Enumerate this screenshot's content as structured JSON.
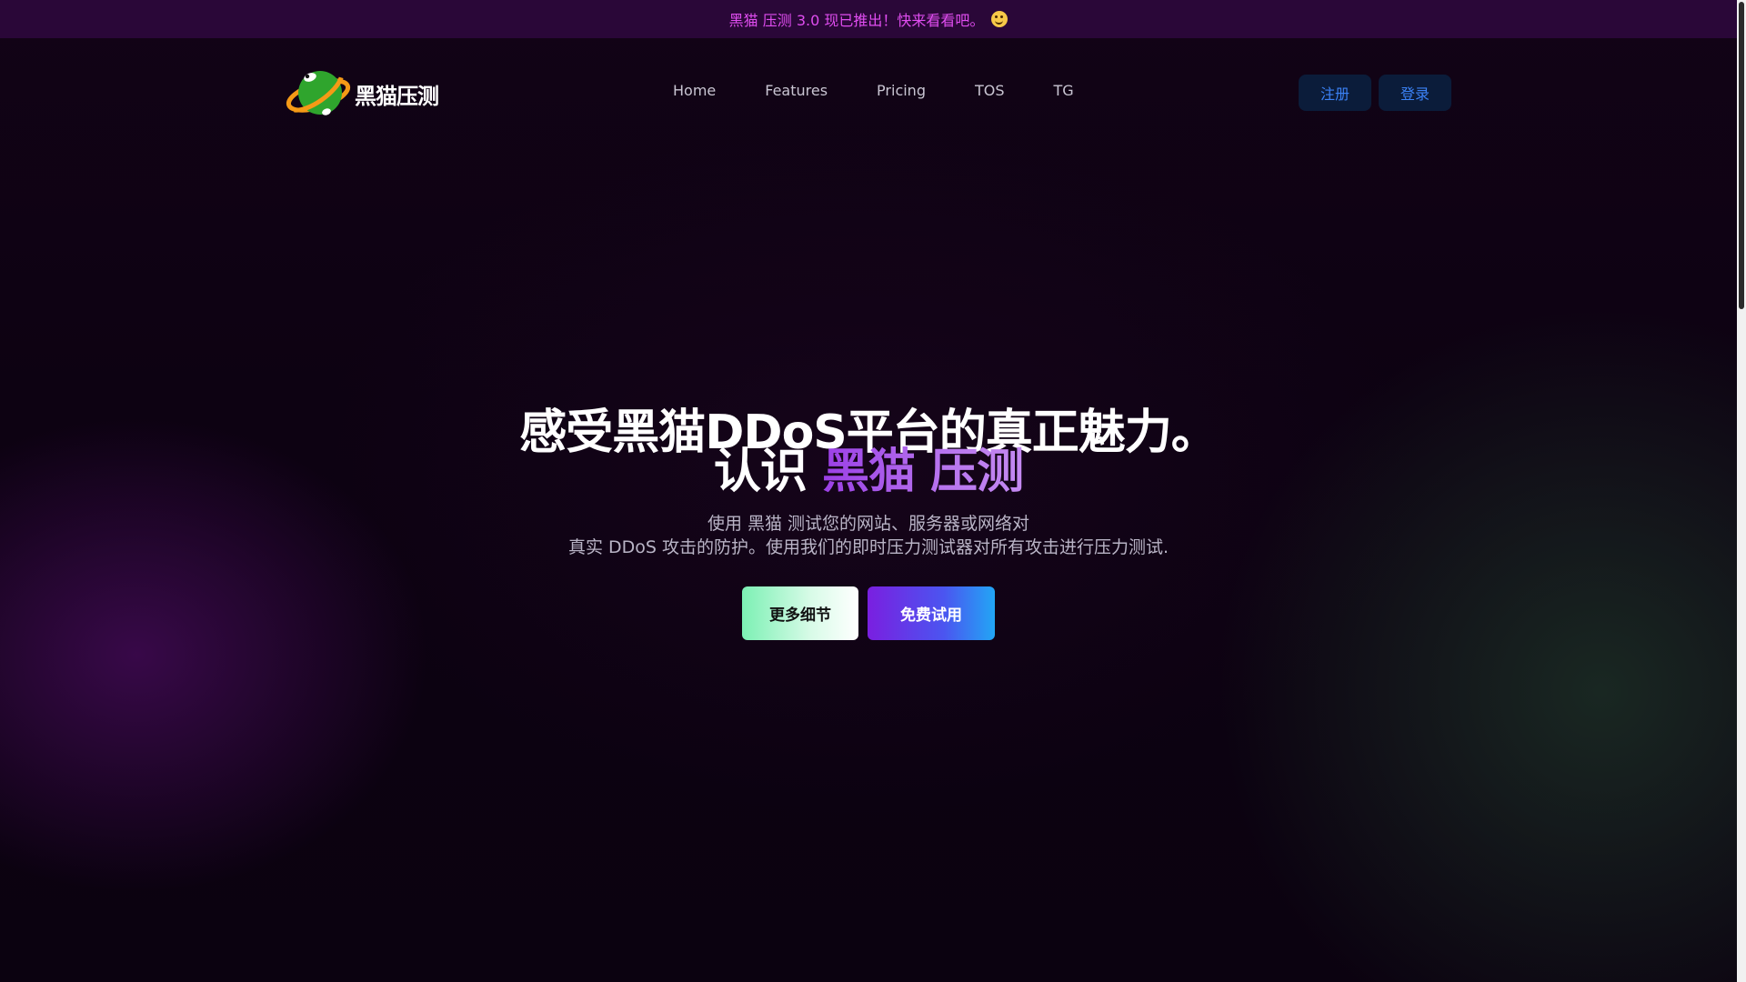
{
  "announcement": {
    "text": "黑猫 压测 3.0 现已推出！快来看看吧。",
    "emoji": "smiley-icon"
  },
  "header": {
    "brand": "黑猫压测",
    "nav": [
      {
        "label": "Home"
      },
      {
        "label": "Features"
      },
      {
        "label": "Pricing"
      },
      {
        "label": "TOS"
      },
      {
        "label": "TG"
      }
    ],
    "register_label": "注册",
    "login_label": "登录"
  },
  "hero": {
    "title_line1": "感受黑猫DDoS平台的真正魅力。",
    "title_line2_prefix": "认识 ",
    "title_line2_accent": "黑猫 压测",
    "subtitle_line1": "使用 黑猫 测试您的网站、服务器或网络对",
    "subtitle_line2": "真实 DDoS 攻击的防护。使用我们的即时压力测试器对所有攻击进行压力测试.",
    "more_label": "更多细节",
    "trial_label": "免费试用"
  },
  "colors": {
    "announce_bg": "#2a0738",
    "announce_text": "#e04df0",
    "accent_purple": "#9b3fe6",
    "auth_button_bg": "#0b1c3a",
    "auth_button_text": "#3b82f6"
  }
}
